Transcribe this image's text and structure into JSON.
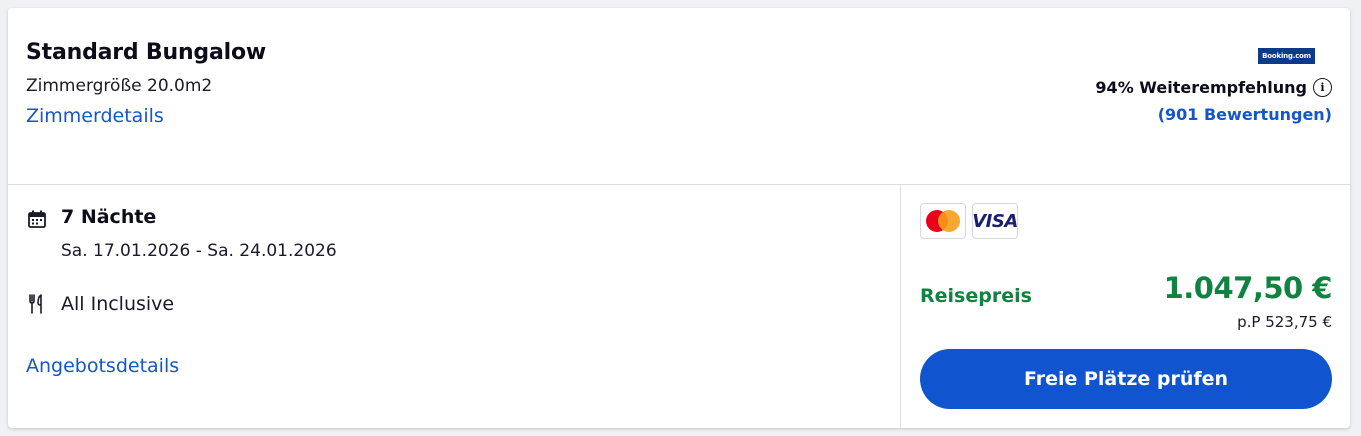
{
  "room": {
    "title": "Standard Bungalow",
    "size": "Zimmergröße 20.0m2",
    "details_link": "Zimmerdetails"
  },
  "rating": {
    "provider_logo_text": "Booking.com",
    "recommendation": "94% Weiterempfehlung",
    "reviews": "(901 Bewertungen)"
  },
  "offer": {
    "nights": "7 Nächte",
    "dates": "Sa. 17.01.2026 - Sa. 24.01.2026",
    "board": "All Inclusive",
    "details_link": "Angebotsdetails"
  },
  "payment": {
    "methods": [
      "mastercard",
      "VISA"
    ],
    "visa_label": "VISA"
  },
  "pricing": {
    "label": "Reisepreis",
    "total": "1.047,50 €",
    "per_person": "p.P 523,75 €",
    "cta": "Freie Plätze prüfen"
  },
  "colors": {
    "link": "#1556c8",
    "price": "#118340",
    "cta": "#1054cf"
  },
  "icons": [
    "calendar-icon",
    "cutlery-icon",
    "info-icon",
    "mastercard-icon",
    "visa-icon"
  ]
}
